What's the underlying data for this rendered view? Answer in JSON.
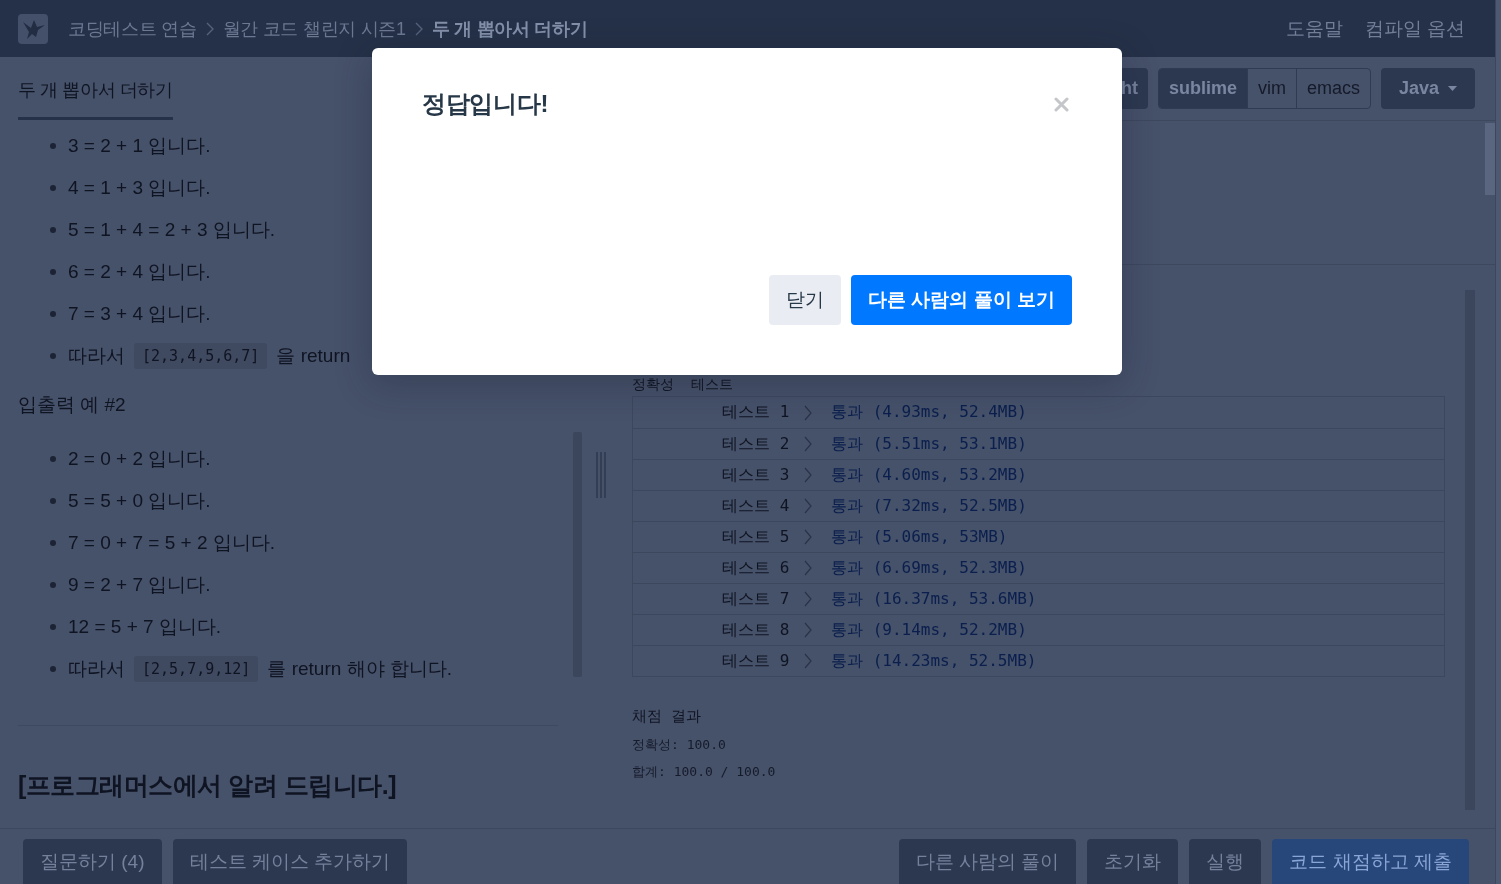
{
  "header": {
    "breadcrumbs": [
      {
        "label": "코딩테스트 연습",
        "current": false
      },
      {
        "label": "월간 코드 챌린지 시즌1",
        "current": false
      },
      {
        "label": "두 개 뽑아서 더하기",
        "current": true
      }
    ],
    "links": [
      "도움말",
      "컴파일 옵션"
    ]
  },
  "problem_panel": {
    "tabs": [
      {
        "label": "두 개 뽑아서 더하기",
        "selected": true
      }
    ],
    "blocks": [
      {
        "kind": "list",
        "items": [
          {
            "kind": "plain",
            "text": "3 = 2 + 1 입니다."
          },
          {
            "kind": "plain",
            "text": "4 = 1 + 3 입니다."
          },
          {
            "kind": "plain",
            "text": "5 = 1 + 4 = 2 + 3 입니다."
          },
          {
            "kind": "plain",
            "text": "6 = 2 + 4 입니다."
          },
          {
            "kind": "plain",
            "text": "7 = 3 + 4 입니다."
          },
          {
            "kind": "code",
            "before": "따라서",
            "code": "[2,3,4,5,6,7]",
            "after": "을 return"
          }
        ]
      },
      {
        "kind": "paragraph",
        "text": "입출력 예 #2"
      },
      {
        "kind": "list",
        "items": [
          {
            "kind": "plain",
            "text": "2 = 0 + 2 입니다."
          },
          {
            "kind": "plain",
            "text": "5 = 5 + 0 입니다."
          },
          {
            "kind": "plain",
            "text": "7 = 0 + 7 = 5 + 2 입니다."
          },
          {
            "kind": "plain",
            "text": "9 = 2 + 7 입니다."
          },
          {
            "kind": "plain",
            "text": "12 = 5 + 7 입니다."
          },
          {
            "kind": "code",
            "before": "따라서",
            "code": "[2,5,7,9,12]",
            "after": "를 return 해야 합니다."
          }
        ]
      },
      {
        "kind": "rule"
      },
      {
        "kind": "heading",
        "text": "[프로그래머스에서 알려 드립니다.]"
      }
    ]
  },
  "editor_toolbar": {
    "theme_button": "ht",
    "keymaps": [
      {
        "label": "sublime",
        "selected": true
      },
      {
        "label": "vim",
        "selected": false
      },
      {
        "label": "emacs",
        "selected": false
      }
    ],
    "language": "Java"
  },
  "results": {
    "section_title": "정확성  테스트",
    "tests": [
      {
        "label": "테스트 1",
        "result": "통과 (4.93ms, 52.4MB)"
      },
      {
        "label": "테스트 2",
        "result": "통과 (5.51ms, 53.1MB)"
      },
      {
        "label": "테스트 3",
        "result": "통과 (4.60ms, 53.2MB)"
      },
      {
        "label": "테스트 4",
        "result": "통과 (7.32ms, 52.5MB)"
      },
      {
        "label": "테스트 5",
        "result": "통과 (5.06ms, 53MB)"
      },
      {
        "label": "테스트 6",
        "result": "통과 (6.69ms, 52.3MB)"
      },
      {
        "label": "테스트 7",
        "result": "통과 (16.37ms, 53.6MB)"
      },
      {
        "label": "테스트 8",
        "result": "통과 (9.14ms, 52.2MB)"
      },
      {
        "label": "테스트 9",
        "result": "통과 (14.23ms, 52.5MB)"
      }
    ],
    "score_title": "채점 결과",
    "score_lines": [
      "정확성: 100.0",
      "합계: 100.0 / 100.0"
    ]
  },
  "bottom_bar": {
    "left_buttons": [
      {
        "label": "질문하기 (4)",
        "kind": "secondary"
      },
      {
        "label": "테스트 케이스 추가하기",
        "kind": "secondary"
      }
    ],
    "right_buttons": [
      {
        "label": "다른 사람의 풀이",
        "kind": "secondary"
      },
      {
        "label": "초기화",
        "kind": "secondary"
      },
      {
        "label": "실행",
        "kind": "secondary"
      },
      {
        "label": "코드 채점하고 제출",
        "kind": "primary"
      }
    ]
  },
  "modal": {
    "title": "정답입니다!",
    "buttons": [
      {
        "label": "닫기",
        "kind": "secondary"
      },
      {
        "label": "다른 사람의 풀이 보기",
        "kind": "primary"
      }
    ]
  }
}
